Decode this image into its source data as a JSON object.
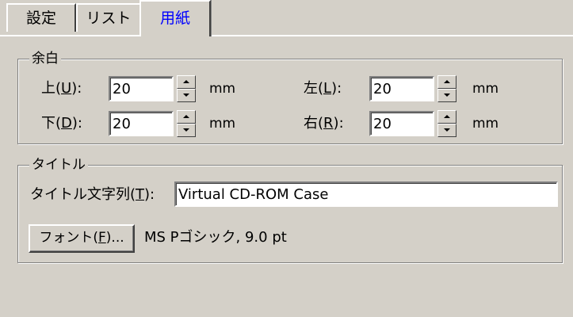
{
  "tabs": [
    {
      "label": "設定"
    },
    {
      "label": "リスト"
    },
    {
      "label": "用紙",
      "selected": true
    }
  ],
  "margin_group": {
    "legend": "余白",
    "top": {
      "prefix": "上(",
      "mnemonic": "U",
      "suffix": "):",
      "value": "20",
      "unit": "mm"
    },
    "bottom": {
      "prefix": "下(",
      "mnemonic": "D",
      "suffix": "):",
      "value": "20",
      "unit": "mm"
    },
    "left": {
      "prefix": "左(",
      "mnemonic": "L",
      "suffix": "):",
      "value": "20",
      "unit": "mm"
    },
    "right": {
      "prefix": "右(",
      "mnemonic": "R",
      "suffix": "):",
      "value": "20",
      "unit": "mm"
    }
  },
  "title_group": {
    "legend": "タイトル",
    "title_label": {
      "prefix": "タイトル文字列(",
      "mnemonic": "T",
      "suffix": "):"
    },
    "title_value": "Virtual CD-ROM Case",
    "font_button": {
      "prefix": "フォント(",
      "mnemonic": "F",
      "suffix": ")..."
    },
    "font_description": "MS Pゴシック, 9.0 pt"
  },
  "colors": {
    "face": "#d4d0c8",
    "selected_tab_text": "#0000ff"
  }
}
